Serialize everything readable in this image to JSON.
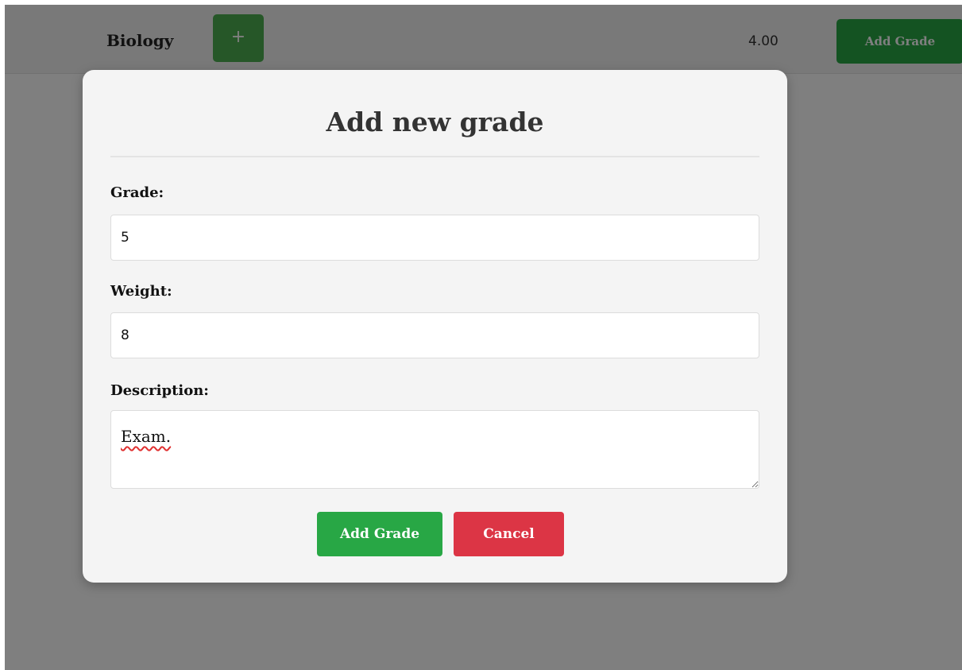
{
  "header": {
    "subject_name": "Biology",
    "toggle_icon": "plus-icon",
    "toggle_symbol": "+",
    "average": "4.00",
    "add_button_label": "Add Grade"
  },
  "modal": {
    "title": "Add new grade",
    "fields": {
      "grade": {
        "label": "Grade:",
        "value": "5"
      },
      "weight": {
        "label": "Weight:",
        "value": "8"
      },
      "description": {
        "label": "Description:",
        "value": "Exam."
      }
    },
    "buttons": {
      "add_label": "Add Grade",
      "cancel_label": "Cancel"
    }
  },
  "colors": {
    "primary_green": "#28a745",
    "danger_red": "#dc3545",
    "modal_background": "#f4f4f4",
    "overlay": "rgba(0,0,0,0.5)"
  }
}
